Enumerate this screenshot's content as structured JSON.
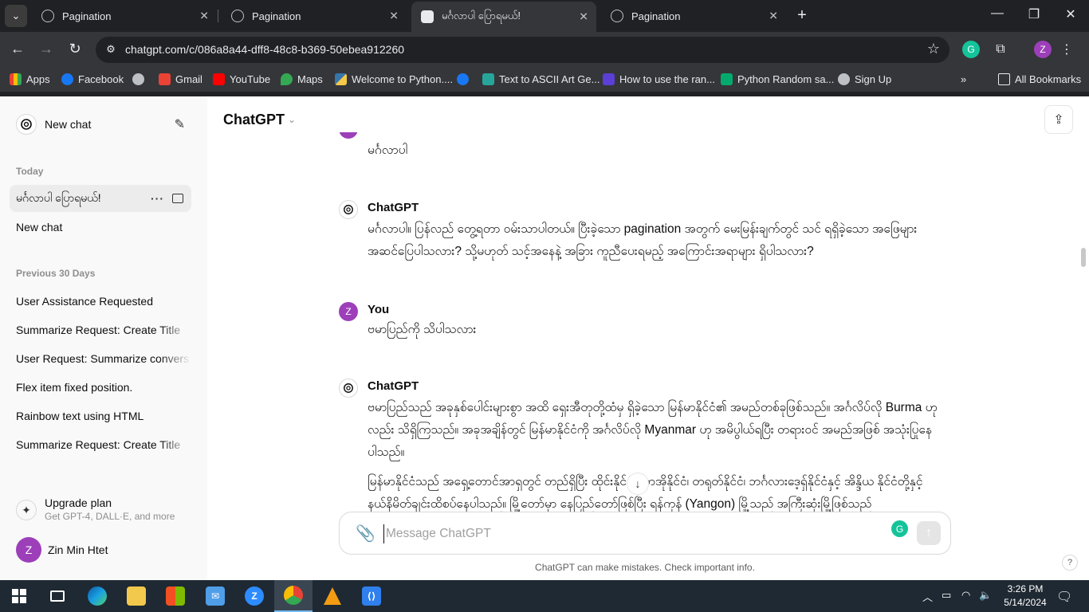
{
  "browser": {
    "tabs": [
      {
        "title": "Pagination",
        "active": false
      },
      {
        "title": "Pagination",
        "active": false
      },
      {
        "title": "မင်္ဂလာပါ ပြောရမယ်!",
        "active": true
      },
      {
        "title": "Pagination",
        "active": false
      }
    ],
    "url": "chatgpt.com/c/086a8a44-dff8-48c8-b369-50ebea912260",
    "profile_initial": "Z",
    "bookmarks": [
      {
        "label": "Apps",
        "icon": "apps-grid-icon",
        "color": "#ea4335"
      },
      {
        "label": "Facebook",
        "icon": "facebook-icon",
        "color": "#1877f2"
      },
      {
        "label": "",
        "icon": "globe-icon",
        "color": "#bdc1c6"
      },
      {
        "label": "Gmail",
        "icon": "gmail-icon",
        "color": "#ea4335"
      },
      {
        "label": "YouTube",
        "icon": "youtube-icon",
        "color": "#ff0000"
      },
      {
        "label": "Maps",
        "icon": "maps-icon",
        "color": "#34a853"
      },
      {
        "label": "Welcome to Python....",
        "icon": "python-icon",
        "color": "#f7c948"
      },
      {
        "label": "",
        "icon": "facebook-icon",
        "color": "#1877f2"
      },
      {
        "label": "Text to ASCII Art Ge...",
        "icon": "ascii-icon",
        "color": "#26a69a"
      },
      {
        "label": "How to use the ran...",
        "icon": "terminal-icon",
        "color": "#5b3fd6"
      },
      {
        "label": "Python Random sa...",
        "icon": "w3schools-icon",
        "color": "#04aa6d"
      },
      {
        "label": "Sign Up",
        "icon": "globe-icon",
        "color": "#bdc1c6"
      }
    ],
    "all_bookmarks_label": "All Bookmarks"
  },
  "sidebar": {
    "new_chat_label": "New chat",
    "today_label": "Today",
    "today_items": [
      {
        "label": "မင်္ဂလာပါ ပြောရမယ်!",
        "active": true
      },
      {
        "label": "New chat",
        "active": false
      }
    ],
    "prev30_label": "Previous 30 Days",
    "prev30_items": [
      "User Assistance Requested",
      "Summarize Request: Create Title",
      "User Request: Summarize convers",
      "Flex item fixed position.",
      "Rainbow text using HTML",
      "Summarize Request: Create Title"
    ],
    "upgrade_title": "Upgrade plan",
    "upgrade_sub": "Get GPT-4, DALL·E, and more",
    "user_name": "Zin Min Htet",
    "user_initial": "Z"
  },
  "main": {
    "model_label": "ChatGPT",
    "messages": [
      {
        "author": "",
        "text": "မင်္ဂလာပါ"
      },
      {
        "author": "ChatGPT",
        "text": "မင်္ဂလာပါ။ ပြန်လည် တွေ့ရတာ ဝမ်းသာပါတယ်။ ပြီးခဲ့သော pagination အတွက် မေးမြန်းချက်တွင် သင် ရရှိခဲ့သော အဖြေများ အဆင်ပြေပါသလား? သို့မဟုတ် သင့်အနေနဲ့ အခြား ကူညီပေးရမည့် အကြောင်းအရာများ ရှိပါသလား?"
      },
      {
        "author": "You",
        "text": "ဗမာပြည်ကို သိပါသလား"
      },
      {
        "author": "ChatGPT",
        "text": "ဗမာပြည်သည် အခုနှစ်ပေါင်းများစွာ အထိ ရှေးအီတုတို့ထံမှ ရှိခဲ့သော မြန်မာနိုင်ငံ၏ အမည်တစ်ခုဖြစ်သည်။ အင်္ဂလိပ်လို Burma ဟုလည်း သိရှိကြသည်။ အခုအချိန်တွင် မြန်မာနိုင်ငံကို အင်္ဂလိပ်လို Myanmar ဟု အမိပွါယ်ရပြီး တရားဝင် အမည်အဖြစ် အသုံးပြုနေပါသည်။"
      },
      {
        "author": "",
        "text": "မြန်မာနိုင်ငံသည် အရှေ့တောင်အာရှတွင် တည်ရှိပြီး ထိုင်းနိုင်ငံ၊ လာအိုနိုင်ငံ၊ တရုတ်နိုင်ငံ၊ ဘင်္ဂလားဒေ့ရှ်နိုင်ငံနှင့် အိန္ဒိယ နိုင်ငံတို့နှင့် နယ်နိမိတ်ချင်းထိစပ်နေပါသည်။ မြို့တော်မှာ နေပြည်တော်ဖြစ်ပြီး ရန်ကုန် (Yangon) မြို့သည် အကြီးဆုံးမြို့ဖြစ်သည်"
      }
    ],
    "composer_placeholder": "Message ChatGPT",
    "disclaimer": "ChatGPT can make mistakes. Check important info.",
    "help_label": "?"
  },
  "taskbar": {
    "apps": [
      {
        "name": "start-icon",
        "color": "#ffffff"
      },
      {
        "name": "task-view-icon",
        "color": "#ffffff"
      },
      {
        "name": "edge-icon",
        "color": "#1ba1e2"
      },
      {
        "name": "file-explorer-icon",
        "color": "#f2c94c"
      },
      {
        "name": "store-icon",
        "color": "#4f9ee8"
      },
      {
        "name": "mail-icon",
        "color": "#4f9ee8"
      },
      {
        "name": "zoom-icon",
        "color": "#2d8cff"
      },
      {
        "name": "chrome-icon",
        "color": "#ea4335"
      },
      {
        "name": "vlc-icon",
        "color": "#f39c12"
      },
      {
        "name": "vscode-icon",
        "color": "#2f80ed"
      }
    ],
    "time": "3:26 PM",
    "date": "5/14/2024"
  }
}
